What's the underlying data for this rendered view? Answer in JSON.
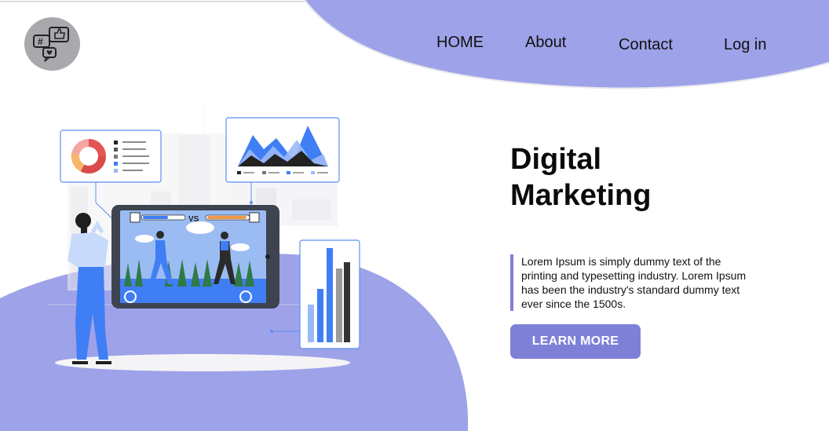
{
  "nav": {
    "home": "HOME",
    "about": "About",
    "contact": "Contact",
    "login": "Log in"
  },
  "logo": {
    "icon": "social-media-icon"
  },
  "hero": {
    "title_line1": "Digital",
    "title_line2": "Marketing",
    "description": "Lorem Ipsum is simply dummy text of the printing and typesetting industry. Lorem Ipsum has been the industry's standard dummy text ever since the 1500s.",
    "cta_label": "LEARN MORE"
  },
  "illustration": {
    "vs_label": "VS"
  },
  "colors": {
    "accent": "#7e80d8",
    "blob": "#9ea2e8",
    "blue": "#3f7ef5"
  }
}
